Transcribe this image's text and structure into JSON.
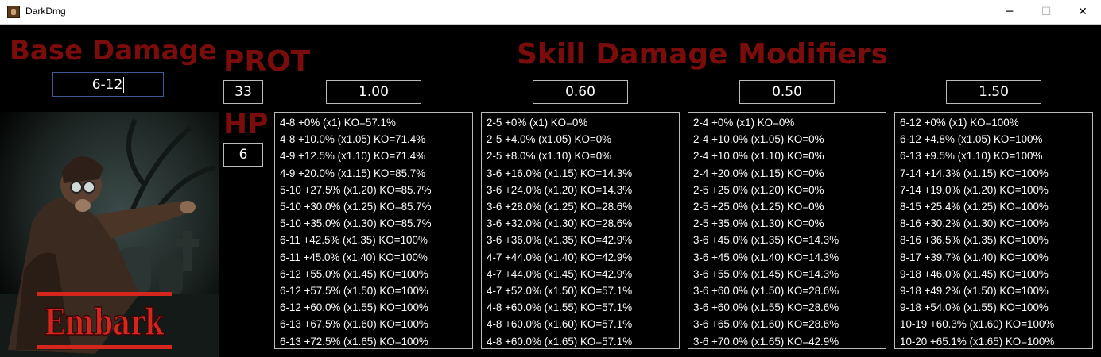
{
  "window": {
    "title": "DarkDmg",
    "minimize_glyph": "─",
    "maximize_glyph": "☐",
    "close_glyph": "✕"
  },
  "labels": {
    "base_damage": "Base Damage",
    "prot": "PROT",
    "hp": "HP",
    "skill_damage_modifiers": "Skill Damage Modifiers",
    "embark": "Embark"
  },
  "inputs": {
    "base_damage": "6-12",
    "prot": "33",
    "hp": "6",
    "modifiers": [
      "1.00",
      "0.60",
      "0.50",
      "1.50"
    ]
  },
  "colors": {
    "heading": "#7a0c0c",
    "embark_text": "#d4261c",
    "field_border": "#bbbbbb",
    "focus_border": "#3c5a95"
  },
  "results": [
    [
      "4-8 +0% (x1) KO=57.1%",
      "4-8 +10.0% (x1.05) KO=71.4%",
      "4-9 +12.5% (x1.10) KO=71.4%",
      "4-9 +20.0% (x1.15) KO=85.7%",
      "5-10 +27.5% (x1.20) KO=85.7%",
      "5-10 +30.0% (x1.25) KO=85.7%",
      "5-10 +35.0% (x1.30) KO=85.7%",
      "6-11 +42.5% (x1.35) KO=100%",
      "6-11 +45.0% (x1.40) KO=100%",
      "6-12 +55.0% (x1.45) KO=100%",
      "6-12 +57.5% (x1.50) KO=100%",
      "6-12 +60.0% (x1.55) KO=100%",
      "6-13 +67.5% (x1.60) KO=100%",
      "6-13 +72.5% (x1.65) KO=100%"
    ],
    [
      "2-5 +0% (x1) KO=0%",
      "2-5 +4.0% (x1.05) KO=0%",
      "2-5 +8.0% (x1.10) KO=0%",
      "3-6 +16.0% (x1.15) KO=14.3%",
      "3-6 +24.0% (x1.20) KO=14.3%",
      "3-6 +28.0% (x1.25) KO=28.6%",
      "3-6 +32.0% (x1.30) KO=28.6%",
      "3-6 +36.0% (x1.35) KO=42.9%",
      "4-7 +44.0% (x1.40) KO=42.9%",
      "4-7 +44.0% (x1.45) KO=42.9%",
      "4-7 +52.0% (x1.50) KO=57.1%",
      "4-8 +60.0% (x1.55) KO=57.1%",
      "4-8 +60.0% (x1.60) KO=57.1%",
      "4-8 +60.0% (x1.65) KO=57.1%"
    ],
    [
      "2-4 +0% (x1) KO=0%",
      "2-4 +10.0% (x1.05) KO=0%",
      "2-4 +10.0% (x1.10) KO=0%",
      "2-4 +20.0% (x1.15) KO=0%",
      "2-5 +25.0% (x1.20) KO=0%",
      "2-5 +25.0% (x1.25) KO=0%",
      "2-5 +35.0% (x1.30) KO=0%",
      "3-6 +45.0% (x1.35) KO=14.3%",
      "3-6 +45.0% (x1.40) KO=14.3%",
      "3-6 +55.0% (x1.45) KO=14.3%",
      "3-6 +60.0% (x1.50) KO=28.6%",
      "3-6 +60.0% (x1.55) KO=28.6%",
      "3-6 +65.0% (x1.60) KO=28.6%",
      "3-6 +70.0% (x1.65) KO=42.9%"
    ],
    [
      "6-12 +0% (x1) KO=100%",
      "6-12 +4.8% (x1.05) KO=100%",
      "6-13 +9.5% (x1.10) KO=100%",
      "7-14 +14.3% (x1.15) KO=100%",
      "7-14 +19.0% (x1.20) KO=100%",
      "8-15 +25.4% (x1.25) KO=100%",
      "8-16 +30.2% (x1.30) KO=100%",
      "8-16 +36.5% (x1.35) KO=100%",
      "8-17 +39.7% (x1.40) KO=100%",
      "9-18 +46.0% (x1.45) KO=100%",
      "9-18 +49.2% (x1.50) KO=100%",
      "9-18 +54.0% (x1.55) KO=100%",
      "10-19 +60.3% (x1.60) KO=100%",
      "10-20 +65.1% (x1.65) KO=100%"
    ]
  ]
}
